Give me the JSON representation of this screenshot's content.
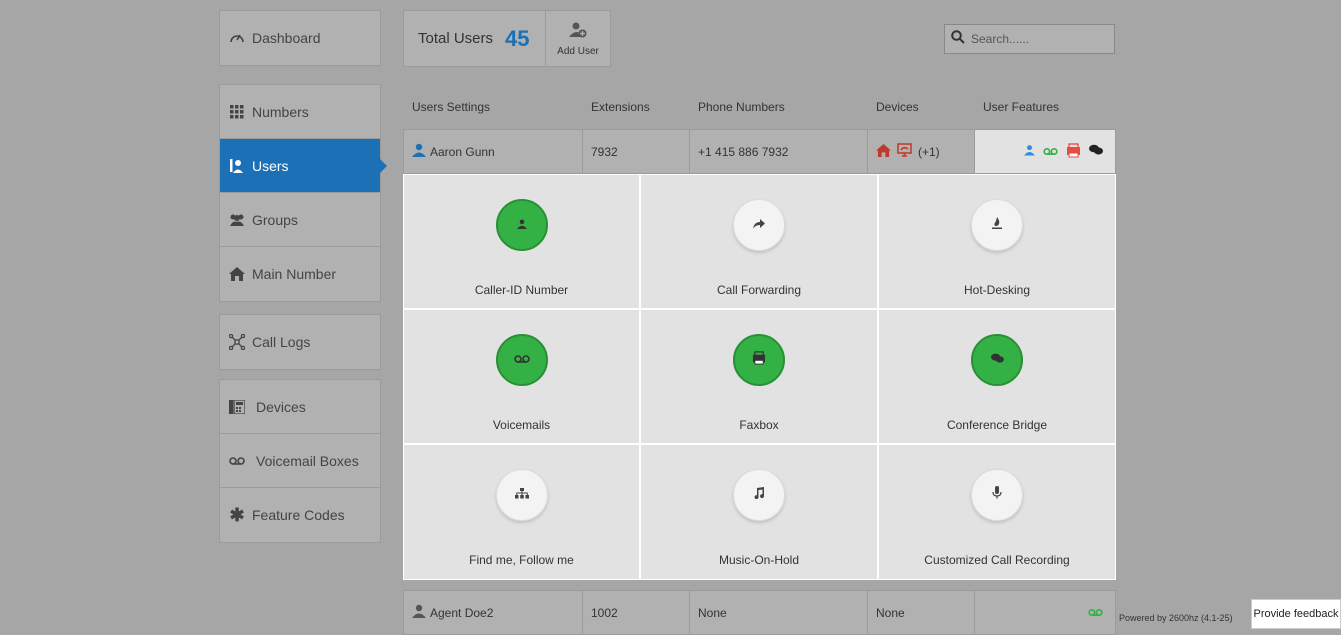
{
  "sidebar": {
    "groups": [
      [
        {
          "label": "Dashboard",
          "icon": "gauge-icon"
        }
      ],
      [
        {
          "label": "Numbers",
          "icon": "grid-icon"
        },
        {
          "label": "Users",
          "icon": "users-icon",
          "active": true
        },
        {
          "label": "Groups",
          "icon": "group-icon"
        },
        {
          "label": "Main Number",
          "icon": "home-icon"
        }
      ],
      [
        {
          "label": "Call Logs",
          "icon": "network-icon"
        }
      ],
      [
        {
          "label": "Devices",
          "icon": "phone-device-icon"
        },
        {
          "label": "Voicemail Boxes",
          "icon": "voicemail-icon"
        },
        {
          "label": "Feature Codes",
          "icon": "asterisk-icon"
        }
      ]
    ]
  },
  "header": {
    "total_label": "Total Users",
    "total_count": "45",
    "add_user_label": "Add User"
  },
  "search": {
    "placeholder": "Search......"
  },
  "table": {
    "columns": [
      "Users Settings",
      "Extensions",
      "Phone Numbers",
      "Devices",
      "User Features"
    ],
    "rows": [
      {
        "name": "Aaron Gunn",
        "extension": "7932",
        "phone": "+1 415 886 7932",
        "devices_extra": "(+1)"
      },
      {
        "name": "Agent Doe2",
        "extension": "1002",
        "phone": "None",
        "devices": "None"
      }
    ]
  },
  "features": [
    {
      "label": "Caller-ID Number",
      "icon": "user-icon",
      "on": true
    },
    {
      "label": "Call Forwarding",
      "icon": "forward-icon",
      "on": false
    },
    {
      "label": "Hot-Desking",
      "icon": "fire-icon",
      "on": false
    },
    {
      "label": "Voicemails",
      "icon": "voicemail-icon",
      "on": true
    },
    {
      "label": "Faxbox",
      "icon": "fax-icon",
      "on": true
    },
    {
      "label": "Conference Bridge",
      "icon": "chat-icon",
      "on": true
    },
    {
      "label": "Find me, Follow me",
      "icon": "sitemap-icon",
      "on": false
    },
    {
      "label": "Music-On-Hold",
      "icon": "music-icon",
      "on": false
    },
    {
      "label": "Customized Call Recording",
      "icon": "microphone-icon",
      "on": false
    }
  ],
  "footer": {
    "powered": "Powered by 2600hz  (4.1-25)",
    "feedback": "Provide feedback"
  },
  "colors": {
    "accent": "#1c70b5",
    "green": "#34b144",
    "red": "#c0392b"
  }
}
